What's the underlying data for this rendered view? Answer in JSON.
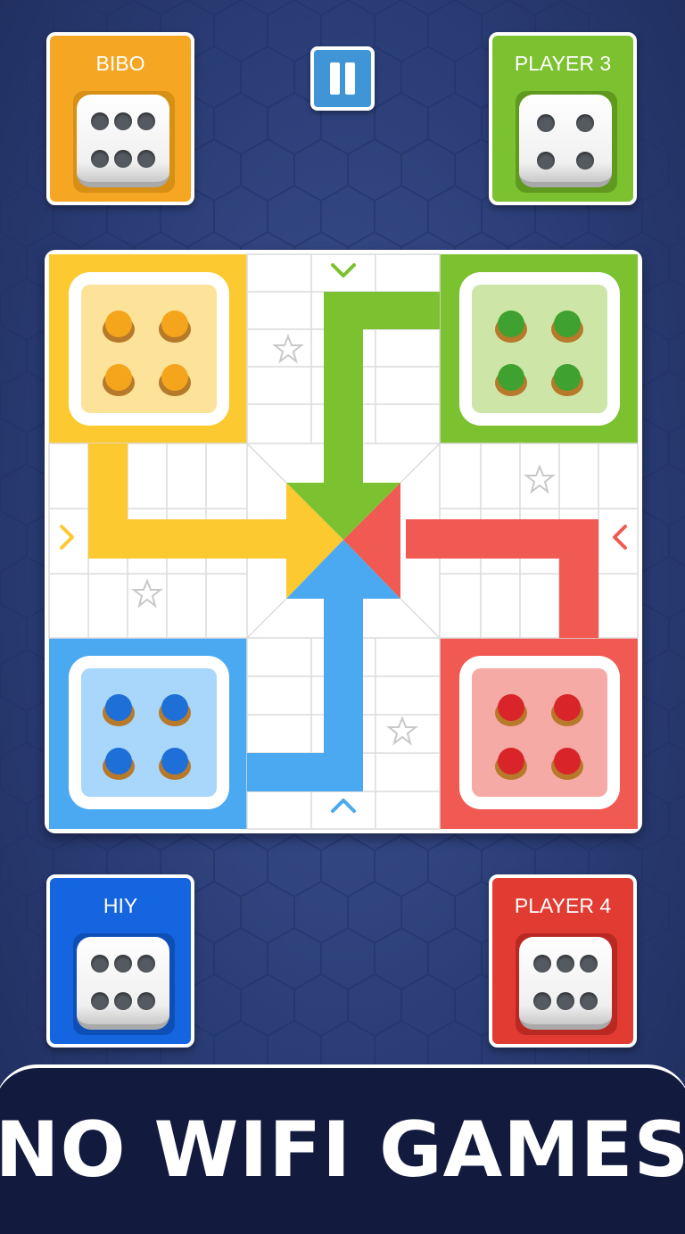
{
  "players": {
    "top_left": {
      "name": "BIBO",
      "color": "#f5a623",
      "dice_value": 6
    },
    "top_right": {
      "name": "PLAYER 3",
      "color": "#7cc12f",
      "dice_value": 4
    },
    "bottom_left": {
      "name": "HIY",
      "color": "#1565e0",
      "dice_value": 6
    },
    "bottom_right": {
      "name": "PLAYER 4",
      "color": "#e13b32",
      "dice_value": 6
    }
  },
  "pause_button": {
    "icon": "pause-icon"
  },
  "board": {
    "colors": {
      "yellow": "#fcc931",
      "green": "#7cc12f",
      "blue": "#4aa9f1",
      "red": "#f05a53"
    },
    "home_pieces": {
      "yellow": 4,
      "green": 4,
      "blue": 4,
      "red": 4
    },
    "star_icon": "star-outline-icon",
    "arrow_icon": "chevron-icon"
  },
  "banner": {
    "text": "NO WIFI GAMES"
  }
}
